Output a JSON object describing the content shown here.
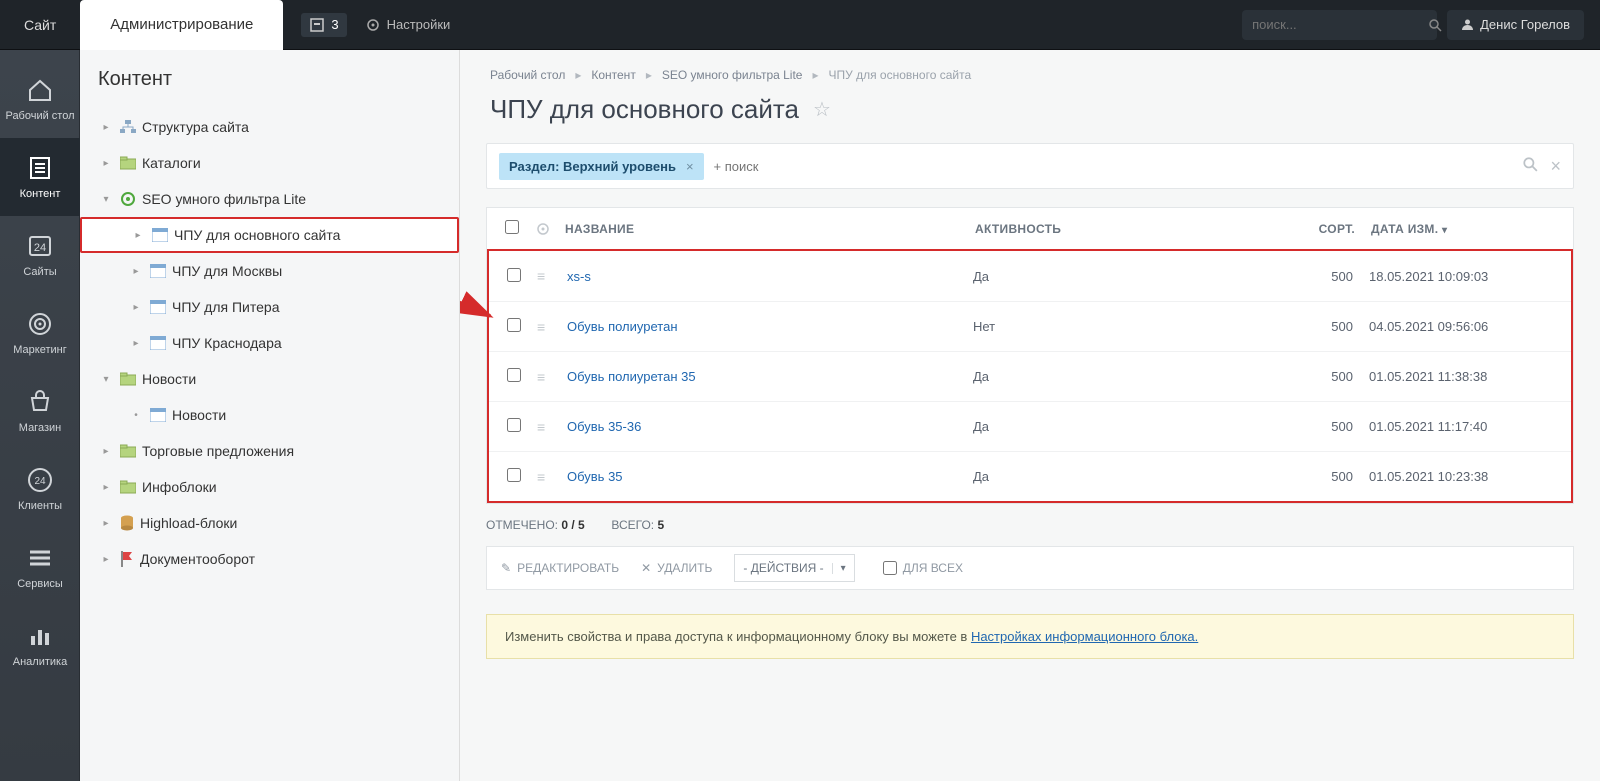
{
  "topbar": {
    "site_tab": "Сайт",
    "admin_tab": "Администрирование",
    "badge_count": "3",
    "settings": "Настройки",
    "search_placeholder": "поиск...",
    "user": "Денис Горелов"
  },
  "iconbar": [
    {
      "id": "desktop",
      "label": "Рабочий стол"
    },
    {
      "id": "content",
      "label": "Контент"
    },
    {
      "id": "sites",
      "label": "Сайты"
    },
    {
      "id": "marketing",
      "label": "Маркетинг"
    },
    {
      "id": "shop",
      "label": "Магазин"
    },
    {
      "id": "clients",
      "label": "Клиенты"
    },
    {
      "id": "services",
      "label": "Сервисы"
    },
    {
      "id": "analytics",
      "label": "Аналитика"
    }
  ],
  "sidebar": {
    "title": "Контент",
    "nodes": [
      {
        "label": "Структура сайта",
        "icon": "sitemap",
        "pad": 18
      },
      {
        "label": "Каталоги",
        "icon": "folder",
        "pad": 18
      },
      {
        "label": "SEO умного фильтра Lite",
        "icon": "seo",
        "pad": 18,
        "open": true
      },
      {
        "label": "ЧПУ для основного сайта",
        "icon": "iblock",
        "pad": 48,
        "hl": true
      },
      {
        "label": "ЧПУ для Москвы",
        "icon": "iblock",
        "pad": 48
      },
      {
        "label": "ЧПУ для Питера",
        "icon": "iblock",
        "pad": 48
      },
      {
        "label": "ЧПУ Краснодара",
        "icon": "iblock",
        "pad": 48
      },
      {
        "label": "Новости",
        "icon": "folder",
        "pad": 18,
        "open": true
      },
      {
        "label": "Новости",
        "icon": "iblock",
        "pad": 48,
        "noarrow": true
      },
      {
        "label": "Торговые предложения",
        "icon": "folder",
        "pad": 18
      },
      {
        "label": "Инфоблоки",
        "icon": "folder",
        "pad": 18
      },
      {
        "label": "Highload-блоки",
        "icon": "db",
        "pad": 18
      },
      {
        "label": "Документооборот",
        "icon": "flag",
        "pad": 18
      }
    ]
  },
  "breadcrumbs": [
    "Рабочий стол",
    "Контент",
    "SEO умного фильтра Lite",
    "ЧПУ для основного сайта"
  ],
  "page_title": "ЧПУ для основного сайта",
  "filter": {
    "chip": "Раздел: Верхний уровень",
    "placeholder": "+ поиск"
  },
  "grid": {
    "headers": {
      "name": "НАЗВАНИЕ",
      "activity": "АКТИВНОСТЬ",
      "sort": "СОРТ.",
      "date": "ДАТА ИЗМ."
    },
    "rows": [
      {
        "name": "xs-s",
        "active": "Да",
        "sort": "500",
        "date": "18.05.2021 10:09:03"
      },
      {
        "name": "Обувь полиуретан",
        "active": "Нет",
        "sort": "500",
        "date": "04.05.2021 09:56:06"
      },
      {
        "name": "Обувь полиуретан 35",
        "active": "Да",
        "sort": "500",
        "date": "01.05.2021 11:38:38"
      },
      {
        "name": "Обувь 35-36",
        "active": "Да",
        "sort": "500",
        "date": "01.05.2021 11:17:40"
      },
      {
        "name": "Обувь 35",
        "active": "Да",
        "sort": "500",
        "date": "01.05.2021 10:23:38"
      }
    ]
  },
  "summary": {
    "selected_label": "ОТМЕЧЕНО:",
    "selected": "0 / 5",
    "total_label": "ВСЕГО:",
    "total": "5"
  },
  "actions": {
    "edit": "РЕДАКТИРОВАТЬ",
    "delete": "УДАЛИТЬ",
    "select": "- ДЕЙСТВИЯ -",
    "all": "ДЛЯ ВСЕХ"
  },
  "notice": {
    "text": "Изменить свойства и права доступа к информационному блоку вы можете в ",
    "link": "Настройках информационного блока."
  }
}
